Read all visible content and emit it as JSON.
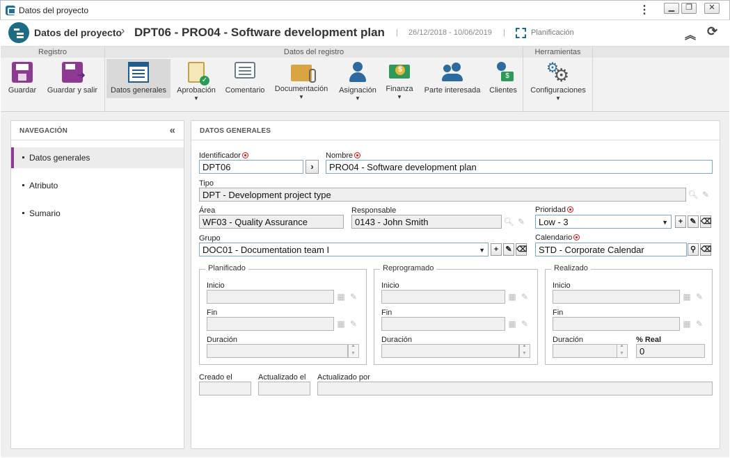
{
  "window": {
    "title": "Datos del proyecto",
    "menu_icon": "kebab-icon",
    "buttons": [
      "minimize-icon",
      "restore-icon",
      "close-icon"
    ]
  },
  "header": {
    "section": "Datos del proyecto",
    "record": "DPT06 - PRO04 - Software development plan",
    "dates": "26/12/2018 - 10/06/2019",
    "status": "Planificación"
  },
  "ribbon": {
    "groups": {
      "registro": "Registro",
      "datos": "Datos del registro",
      "herramientas": "Herramientas"
    },
    "buttons": {
      "guardar": "Guardar",
      "guardar_salir": "Guardar y salir",
      "datos_generales": "Datos generales",
      "aprobacion": "Aprobación",
      "comentario": "Comentario",
      "documentacion": "Documentación",
      "asignacion": "Asignación",
      "finanza": "Finanza",
      "parte_interesada": "Parte interesada",
      "clientes": "Clientes",
      "configuraciones": "Configuraciones"
    }
  },
  "navigation": {
    "title": "NAVEGACIÓN",
    "items": [
      {
        "label": "Datos generales",
        "active": true
      },
      {
        "label": "Atributo",
        "active": false
      },
      {
        "label": "Sumario",
        "active": false
      }
    ]
  },
  "form": {
    "title": "DATOS GENERALES",
    "identificador": {
      "label": "Identificador",
      "value": "DPT06"
    },
    "nombre": {
      "label": "Nombre",
      "value": "PRO04 - Software development plan"
    },
    "tipo": {
      "label": "Tipo",
      "value": "DPT - Development project type"
    },
    "area": {
      "label": "Área",
      "value": "WF03 - Quality Assurance"
    },
    "responsable": {
      "label": "Responsable",
      "value": "0143 - John Smith"
    },
    "prioridad": {
      "label": "Prioridad",
      "value": "Low - 3"
    },
    "grupo": {
      "label": "Grupo",
      "value": "DOC01 - Documentation team I"
    },
    "calendario": {
      "label": "Calendario",
      "value": "STD - Corporate Calendar"
    },
    "planificado": {
      "legend": "Planificado",
      "inicio": "Inicio",
      "fin": "Fin",
      "duracion": "Duración"
    },
    "reprogramado": {
      "legend": "Reprogramado",
      "inicio": "Inicio",
      "fin": "Fin",
      "duracion": "Duración"
    },
    "realizado": {
      "legend": "Realizado",
      "inicio": "Inicio",
      "fin": "Fin",
      "duracion": "Duración",
      "real_label": "% Real",
      "real_value": "0"
    },
    "creado_el": "Creado el",
    "actualizado_el": "Actualizado el",
    "actualizado_por": "Actualizado por"
  }
}
